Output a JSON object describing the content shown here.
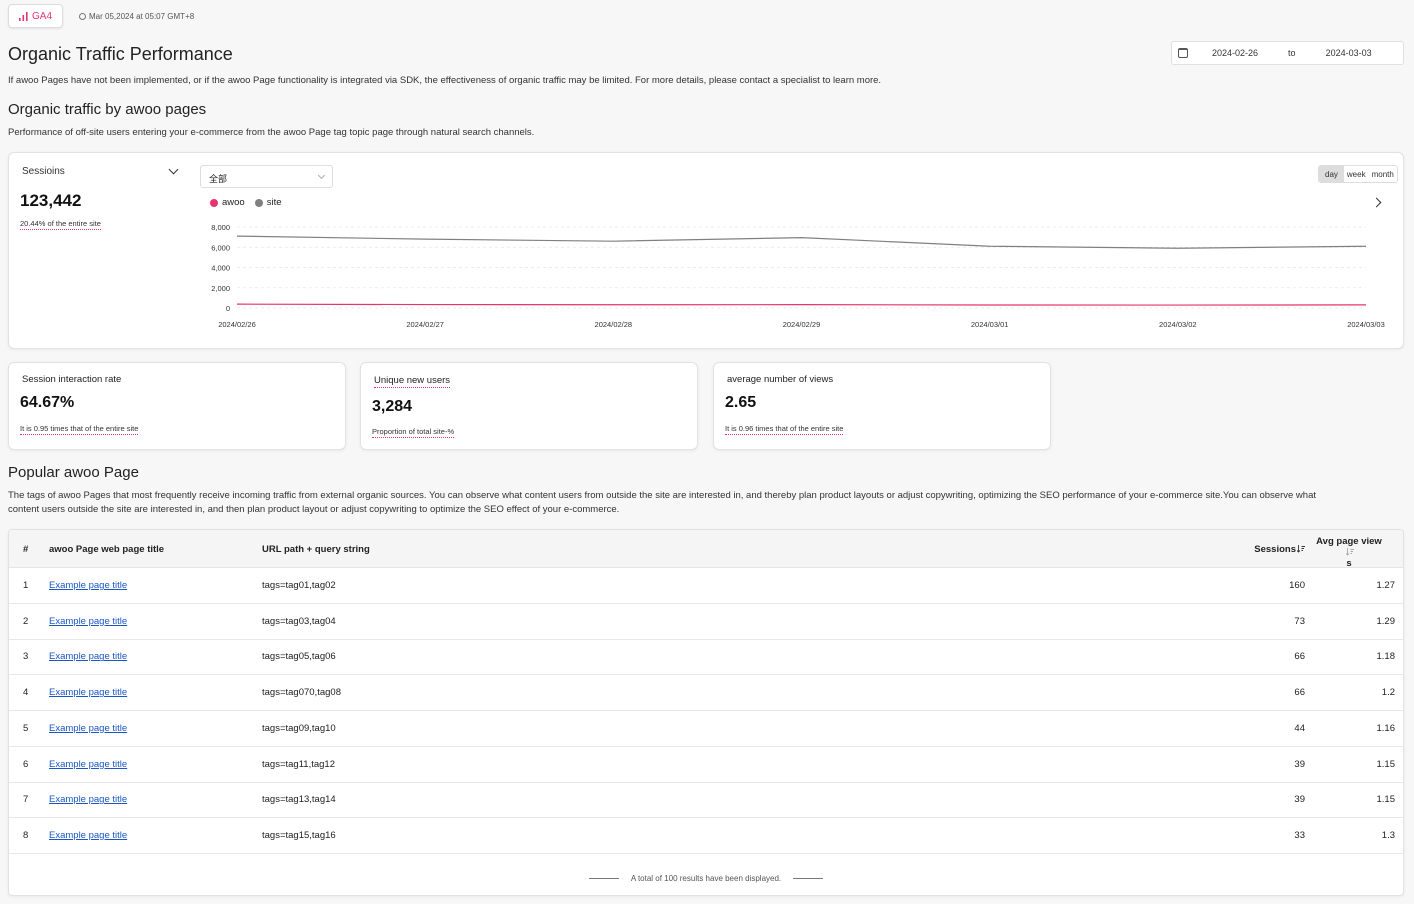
{
  "header": {
    "ga4_label": "GA4",
    "timestamp": "Mar 05,2024 at 05:07 GMT+8",
    "page_title": "Organic Traffic Performance",
    "date_start": "2024-02-26",
    "date_to": "to",
    "date_end": "2024-03-03",
    "notice": "If awoo Pages have not been implemented, or if the awoo Page functionality is integrated via SDK, the effectiveness of organic traffic may be limited. For more details, please contact a specialist to learn more."
  },
  "organic_section": {
    "title": "Organic traffic by awoo pages",
    "description": "Performance of off-site users entering your e-commerce from the awoo Page tag topic page through natural search channels."
  },
  "chart_card": {
    "metric_label": "Sessioins",
    "metric_value": "123,442",
    "metric_note": "20.44% of the entire site",
    "filter_value": "全部",
    "granularity": [
      "day",
      "week",
      "month"
    ],
    "granularity_active": "day"
  },
  "chart_data": {
    "type": "line",
    "x": [
      "2024/02/26",
      "2024/02/27",
      "2024/02/28",
      "2024/02/29",
      "2024/03/01",
      "2024/03/02",
      "2024/03/03"
    ],
    "series": [
      {
        "name": "awoo",
        "color": "#e8336b",
        "values": [
          380,
          340,
          320,
          330,
          300,
          290,
          310
        ]
      },
      {
        "name": "site",
        "color": "#808080",
        "values": [
          7100,
          6800,
          6600,
          6950,
          6100,
          5900,
          6100
        ]
      }
    ],
    "yticks": [
      "8,000",
      "6,000",
      "4,000",
      "2,000",
      "0"
    ],
    "ylim": [
      0,
      8000
    ],
    "grid": true,
    "legend_position": "top-left"
  },
  "kpis": [
    {
      "label": "Session interaction rate",
      "value": "64.67%",
      "note": "It is 0.95 times that of the entire site"
    },
    {
      "label": "Unique new users",
      "value": "3,284",
      "note": "Proportion of total site-%"
    },
    {
      "label": "average number of views",
      "value": "2.65",
      "note": "It is 0.96 times that of the entire site"
    }
  ],
  "popular_section": {
    "title": "Popular awoo Page",
    "description_line1": "The tags of awoo Pages that most frequently receive incoming traffic from external organic sources. You can observe what content users from outside the site are interested in, and thereby plan product layouts or adjust copywriting, optimizing the SEO performance of your e-commerce site.You can observe what",
    "description_line2": "content users outside the site are interested in, and then plan product layout or adjust copywriting to optimize the SEO effect of your e-commerce."
  },
  "table": {
    "headers": {
      "num": "#",
      "title": "awoo Page web page title",
      "url": "URL path + query string",
      "sessions": "Sessions",
      "avg_line1": "Avg page view",
      "avg_line2": "s"
    },
    "rows": [
      {
        "num": "1",
        "title": "Example page title",
        "url": "tags=tag01,tag02",
        "sessions": "160",
        "avg": "1.27"
      },
      {
        "num": "2",
        "title": "Example page title",
        "url": "tags=tag03,tag04",
        "sessions": "73",
        "avg": "1.29"
      },
      {
        "num": "3",
        "title": "Example page title",
        "url": "tags=tag05,tag06",
        "sessions": "66",
        "avg": "1.18"
      },
      {
        "num": "4",
        "title": "Example page title",
        "url": "tags=tag070,tag08",
        "sessions": "66",
        "avg": "1.2"
      },
      {
        "num": "5",
        "title": "Example page title",
        "url": "tags=tag09,tag10",
        "sessions": "44",
        "avg": "1.16"
      },
      {
        "num": "6",
        "title": "Example page title",
        "url": "tags=tag11,tag12",
        "sessions": "39",
        "avg": "1.15"
      },
      {
        "num": "7",
        "title": "Example page title",
        "url": "tags=tag13,tag14",
        "sessions": "39",
        "avg": "1.15"
      },
      {
        "num": "8",
        "title": "Example page title",
        "url": "tags=tag15,tag16",
        "sessions": "33",
        "avg": "1.3"
      }
    ],
    "footer": "A total of 100 results have been displayed."
  }
}
